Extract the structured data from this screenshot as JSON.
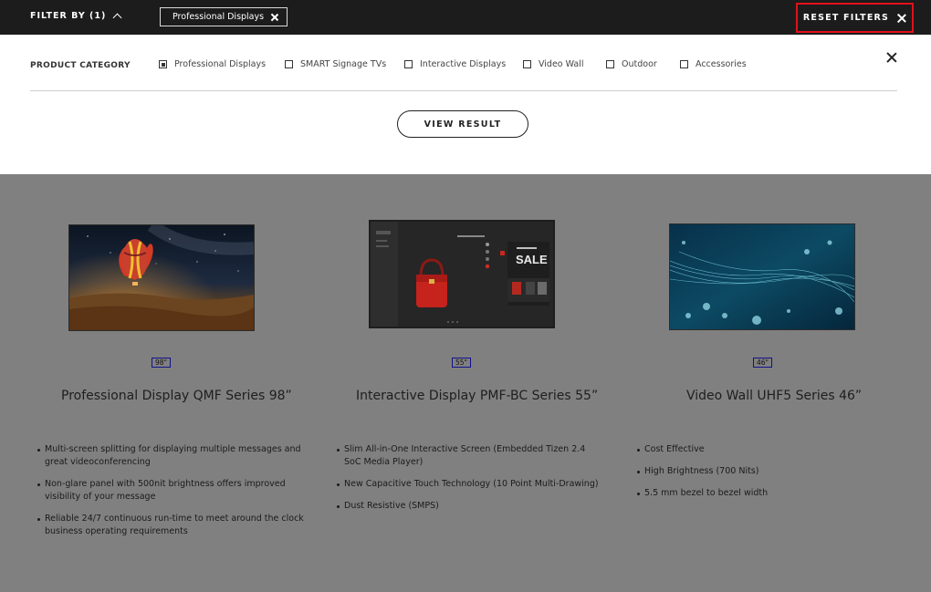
{
  "topbar": {
    "filter_by_label": "FILTER BY (1)",
    "active_chip": "Professional Displays",
    "reset_label": "RESET FILTERS"
  },
  "panel": {
    "category_label": "PRODUCT CATEGORY",
    "options": [
      {
        "label": "Professional Displays",
        "checked": true
      },
      {
        "label": "SMART Signage TVs",
        "checked": false
      },
      {
        "label": "Interactive Displays",
        "checked": false
      },
      {
        "label": "Video Wall",
        "checked": false
      },
      {
        "label": "Outdoor",
        "checked": false
      },
      {
        "label": "Accessories",
        "checked": false
      }
    ],
    "view_result_label": "VIEW RESULT"
  },
  "products": [
    {
      "size": "98\"",
      "title": "Professional Display QMF Series 98”",
      "features": [
        "Multi-screen splitting for displaying multiple messages and great videoconferencing",
        "Non-glare panel with 500nit brightness offers improved visibility of your message",
        "Reliable 24/7 continuous run-time to meet around the clock business operating requirements"
      ]
    },
    {
      "size": "55\"",
      "title": "Interactive Display PMF-BC Series 55”",
      "features": [
        "Slim All-in-One Interactive Screen (Embedded Tizen 2.4 SoC Media Player)",
        "New Capacitive Touch Technology (10 Point Multi-Drawing)",
        "Dust Resistive (SMPS)"
      ],
      "screen_text": "SALE"
    },
    {
      "size": "46\"",
      "title": "Video Wall UHF5 Series 46”",
      "features": [
        "Cost Effective",
        "High Brightness (700 Nits)",
        "5.5 mm bezel to bezel width"
      ]
    }
  ],
  "colors": {
    "topbar_bg": "#1c1c1c",
    "overlay_bg": "#808080",
    "reset_highlight": "#e3101a",
    "size_tag_border": "#10108c"
  }
}
